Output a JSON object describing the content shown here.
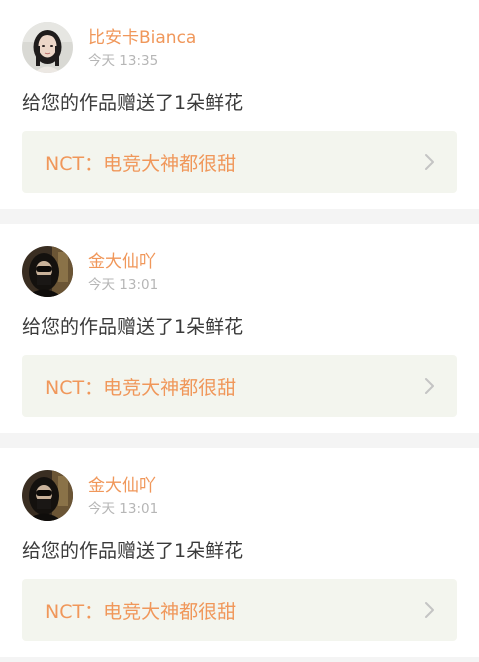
{
  "colors": {
    "accent": "#f0975a",
    "card_link_bg": "#f3f5ee",
    "chevron": "#c4c4c4",
    "timestamp": "#b6b6b6",
    "text": "#3a3a3a"
  },
  "notifications": [
    {
      "username": "比安卡Bianca",
      "time": "今天 13:35",
      "message": "给您的作品赠送了1朵鲜花",
      "work_title": "NCT：电竞大神都很甜",
      "avatar_icon": "avatar-woman-dark-hair-icon",
      "chevron_icon": "chevron-right-icon"
    },
    {
      "username": "金大仙吖",
      "time": "今天 13:01",
      "message": "给您的作品赠送了1朵鲜花",
      "work_title": "NCT：电竞大神都很甜",
      "avatar_icon": "avatar-dark-photo-icon",
      "chevron_icon": "chevron-right-icon"
    },
    {
      "username": "金大仙吖",
      "time": "今天 13:01",
      "message": "给您的作品赠送了1朵鲜花",
      "work_title": "NCT：电竞大神都很甜",
      "avatar_icon": "avatar-dark-photo-icon",
      "chevron_icon": "chevron-right-icon"
    }
  ]
}
